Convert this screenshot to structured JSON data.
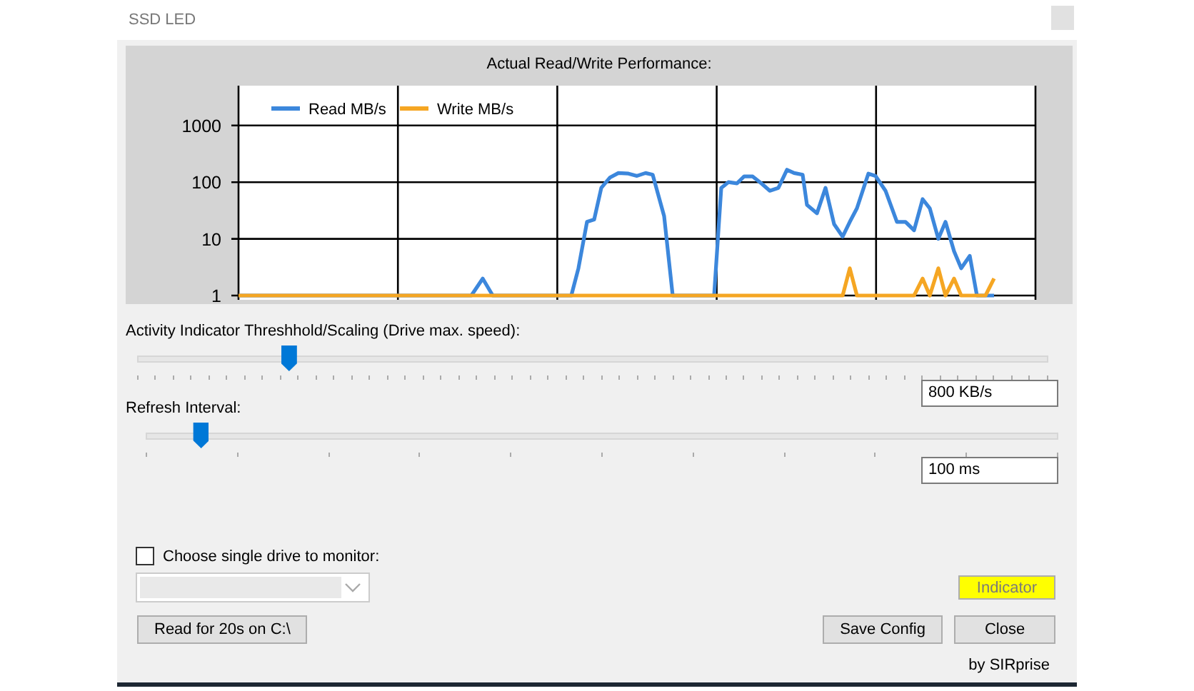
{
  "window": {
    "title": "SSD LED"
  },
  "chart": {
    "title": "Actual Read/Write Performance:",
    "y_axis_labels": [
      "1000",
      "100",
      "10",
      "1"
    ],
    "legend": [
      {
        "name": "Read MB/s",
        "color": "#3c87dc"
      },
      {
        "name": "Write MB/s",
        "color": "#f5a623"
      }
    ]
  },
  "sliders": [
    {
      "label": "Activity Indicator Threshhold/Scaling (Drive max. speed):",
      "level": 0.166,
      "value": "800 KB/s"
    },
    {
      "label": "Refresh Interval:",
      "level": 0.06,
      "value": "100 ms"
    }
  ],
  "drive_option": {
    "label": "Choose single drive to monitor:",
    "checked": false
  },
  "drive_dropdown": {
    "disabled": true
  },
  "indicator": {
    "label": "Indicator",
    "color": "#ffff00"
  },
  "buttons": [
    {
      "label": "Read for 20s on C:\\"
    },
    {
      "label": "Save Config"
    },
    {
      "label": "Close"
    }
  ],
  "credit": "by SIRprise"
}
